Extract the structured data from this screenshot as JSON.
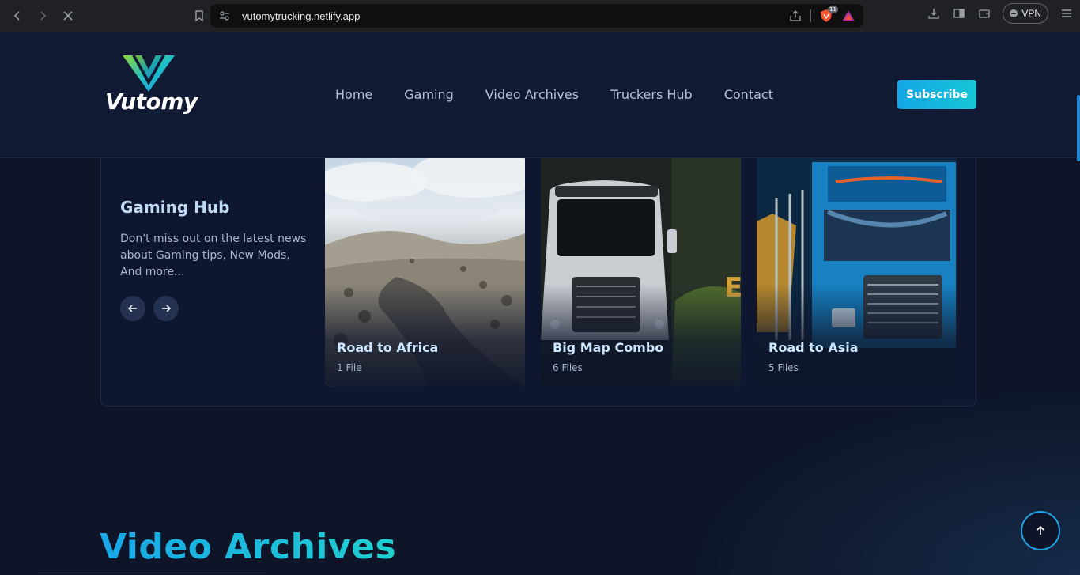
{
  "browser": {
    "url": "vutomytrucking.netlify.app",
    "shield_badge": "11",
    "vpn_label": "VPN"
  },
  "site": {
    "logo_text": "Vutomy",
    "nav": [
      "Home",
      "Gaming",
      "Video Archives",
      "Truckers Hub",
      "Contact"
    ],
    "subscribe_label": "Subscribe"
  },
  "gaming": {
    "title": "Gaming Hub",
    "description": "Don't miss out on the latest news about Gaming tips, New Mods, And more...",
    "cards": [
      {
        "title": "Road to Africa",
        "files": "1 File"
      },
      {
        "title": "Big Map Combo",
        "files": "6 Files"
      },
      {
        "title": "Road to Asia",
        "files": "5 Files"
      }
    ]
  },
  "video_archives": {
    "heading": "Video Archives"
  },
  "colors": {
    "background": "#0e1529",
    "accent": "#12a6e6",
    "accent_2": "#17c6d6"
  }
}
